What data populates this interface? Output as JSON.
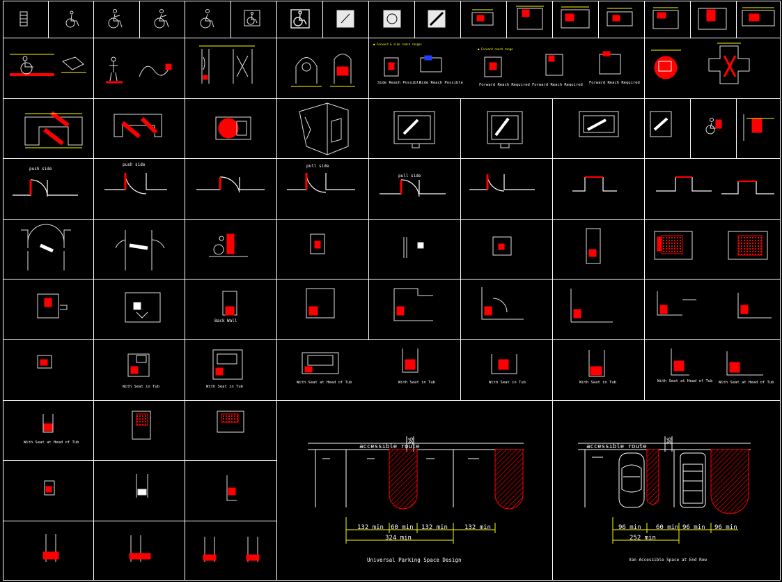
{
  "colors": {
    "background": "#000000",
    "frame": "#ffffff",
    "accent": "#ff0000",
    "dimension": "#ffff00",
    "drawing": "#d8d8d8",
    "text": "#ffffff"
  },
  "row3_labels": {
    "push_side_1": "push side",
    "push_side_2": "push side",
    "pull_side_1": "pull side",
    "pull_side_2": "pull side"
  },
  "row1_labels": {
    "side_reach_possible_1": "Side Reach Possible",
    "side_reach_possible_2": "Side Reach Possible",
    "forward_reach_required_1": "Forward Reach Required",
    "forward_reach_required_2": "Forward Reach Required",
    "forward_reach_required_3": "Forward Reach Required"
  },
  "row5_labels": {
    "back_wall": "Back Wall"
  },
  "row6_labels": {
    "with_seat_in_tub_1": "With Seat in Tub",
    "with_seat_in_tub_2": "With Seat in Tub",
    "with_seat_at_head_1": "With Seat at Head of Tub",
    "with_seat_in_tub_3": "With Seat in Tub",
    "with_seat_in_tub_4": "With Seat in Tub",
    "with_seat_in_tub_5": "With Seat in Tub",
    "with_seat_at_head_2": "With Seat at Head of Tub",
    "with_seat_at_head_3": "With Seat at Head of Tub",
    "with_seat_at_head_4": "With Seat at Head of Tub"
  },
  "parking_universal": {
    "route_label": "accessible route",
    "route_width": "36",
    "dim_1": "132 min",
    "dim_2": "60 min",
    "dim_3": "132 min",
    "dim_4": "132 min",
    "dim_total": "324 min",
    "title": "Universal Parking Space Design"
  },
  "parking_van": {
    "route_label": "accessible route",
    "route_width": "36",
    "dim_1": "96 min",
    "dim_2": "60 min",
    "dim_3": "96 min",
    "dim_4": "96 min",
    "dim_total": "252 min",
    "title": "Van Accessible Space at End Row"
  }
}
